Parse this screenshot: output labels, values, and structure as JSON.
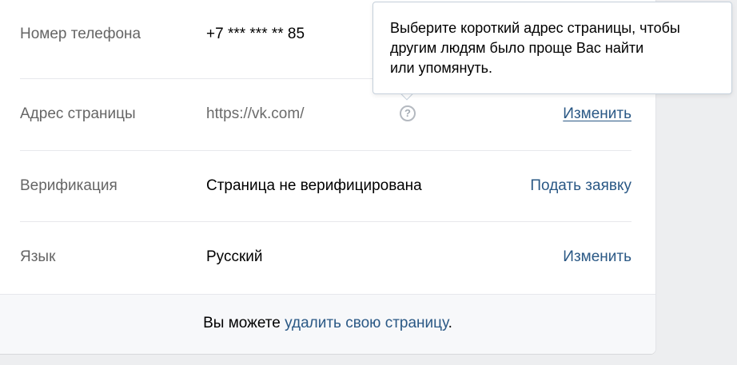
{
  "settings": {
    "rows": [
      {
        "label": "Номер телефона",
        "value": "+7 *** *** ** 85",
        "action": ""
      },
      {
        "label": "Адрес страницы",
        "value": "https://vk.com/",
        "action": "Изменить"
      },
      {
        "label": "Верификация",
        "value": "Страница не верифицирована",
        "action": "Подать заявку"
      },
      {
        "label": "Язык",
        "value": "Русский",
        "action": "Изменить"
      }
    ],
    "help_icon_glyph": "?"
  },
  "tooltip": {
    "lines": [
      "Выберите короткий адрес страницы, чтобы",
      "другим людям было проще Вас найти",
      "или упомянуть."
    ]
  },
  "footer": {
    "prefix": "Вы можете ",
    "link": "удалить свою страницу",
    "suffix": "."
  },
  "colors": {
    "link": "#2a5885",
    "label": "#656565",
    "background": "#edeef0"
  }
}
